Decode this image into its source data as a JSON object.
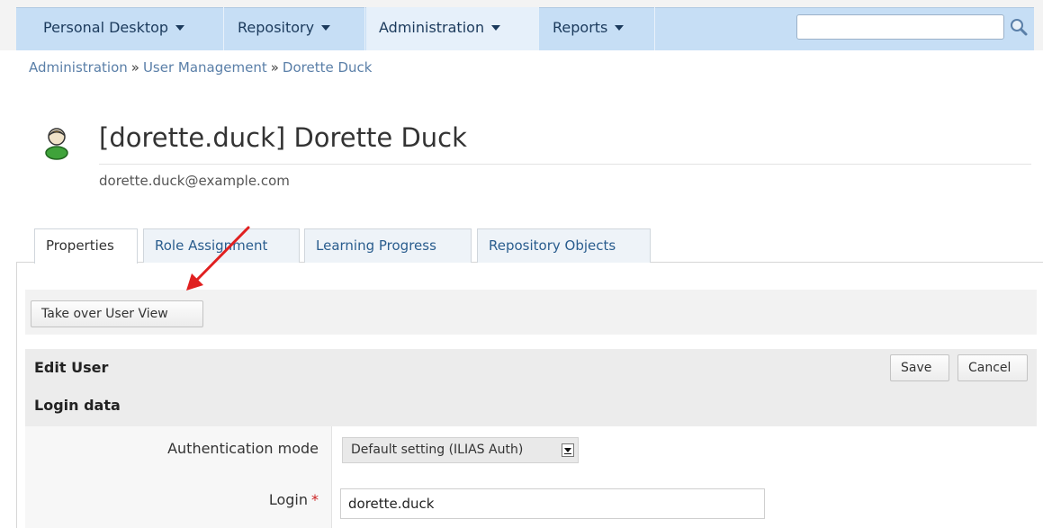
{
  "nav": {
    "items": [
      {
        "label": "Personal Desktop"
      },
      {
        "label": "Repository"
      },
      {
        "label": "Administration"
      },
      {
        "label": "Reports"
      }
    ],
    "search": {
      "value": "",
      "icon": "search-icon"
    }
  },
  "breadcrumb": {
    "items": [
      "Administration",
      "User Management",
      "Dorette Duck"
    ],
    "separator": "»"
  },
  "header": {
    "title": "[dorette.duck] Dorette Duck",
    "email": "dorette.duck@example.com",
    "icon": "user-icon"
  },
  "tabs": [
    {
      "label": "Properties",
      "active": true
    },
    {
      "label": "Role Assignment"
    },
    {
      "label": "Learning Progress"
    },
    {
      "label": "Repository Objects"
    }
  ],
  "toolbar": {
    "take_over_label": "Take over User View"
  },
  "form": {
    "title": "Edit User",
    "save_label": "Save",
    "cancel_label": "Cancel",
    "section": "Login data",
    "fields": {
      "auth_mode_label": "Authentication mode",
      "auth_mode_value": "Default setting (ILIAS Auth)",
      "login_label": "Login",
      "required_mark": "*",
      "login_value": "dorette.duck"
    }
  },
  "colors": {
    "annotation_arrow": "#e02020",
    "nav_bg": "#c6def5",
    "link": "#2a5d8e"
  }
}
